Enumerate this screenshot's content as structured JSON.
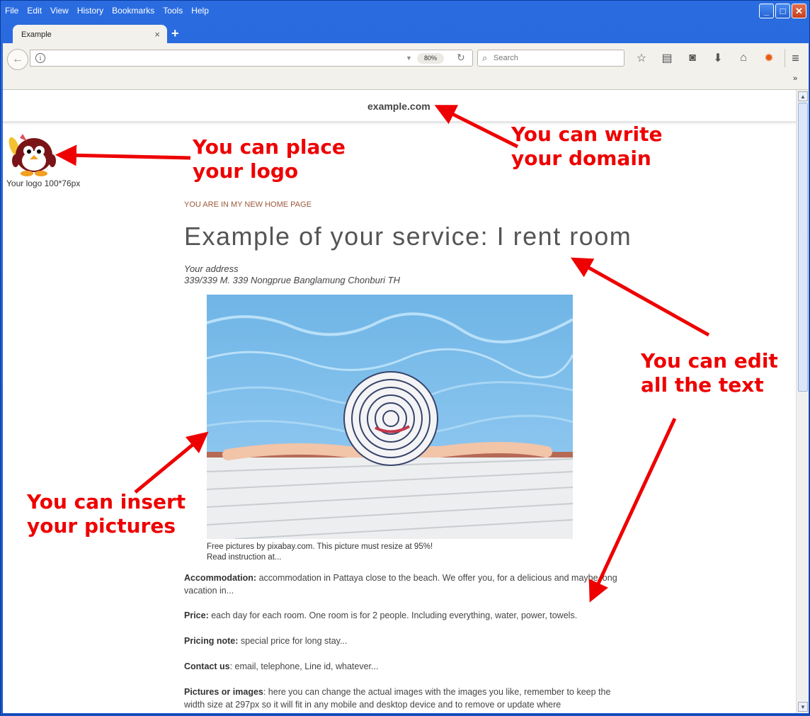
{
  "menu": [
    "File",
    "Edit",
    "View",
    "History",
    "Bookmarks",
    "Tools",
    "Help"
  ],
  "tab": {
    "title": "Example",
    "close": "×",
    "new": "+"
  },
  "nav": {
    "zoom": "80%",
    "search_placeholder": "Search",
    "overflow": "»"
  },
  "page": {
    "domain": "example.com",
    "logo_caption": "Your logo 100*76px",
    "crumb": "YOU ARE IN MY NEW HOME PAGE",
    "title": "Example of your service: I rent room",
    "address_label": "Your address",
    "address": "339/339 M. 339 Nongprue Banglamung Chonburi TH",
    "caption_1": "Free pictures by pixabay.com. This picture must resize at 95%!",
    "caption_2": "Read instruction at...",
    "accommodation_label": "Accommodation:",
    "accommodation": " accommodation in Pattaya close to the beach. We offer you, for a delicious and maybe long vacation in...",
    "price_label": "Price:",
    "price": " each day for each room. One room is for 2 people. Including everything, water, power, towels.",
    "pricing_note_label": "Pricing note:",
    "pricing_note": " special price for long stay...",
    "contact_label": "Contact us",
    "contact": ": email, telephone, Line id, whatever...",
    "pictures_label": "Pictures or images",
    "pictures": ": here you can change the actual images with the images you like, remember to keep the width size at 297px so it will fit in any mobile and desktop device and to remove or update where"
  },
  "annotations": {
    "logo": [
      "You can place",
      "your logo"
    ],
    "domain": [
      "You can write",
      "your domain"
    ],
    "text": [
      "You can edit",
      "all the text"
    ],
    "pictures": [
      "You can insert",
      "your pictures"
    ]
  },
  "colors": {
    "annotation": "#ee0000",
    "titlebar": "#2a6ce0",
    "chrome": "#f3f1ec"
  }
}
